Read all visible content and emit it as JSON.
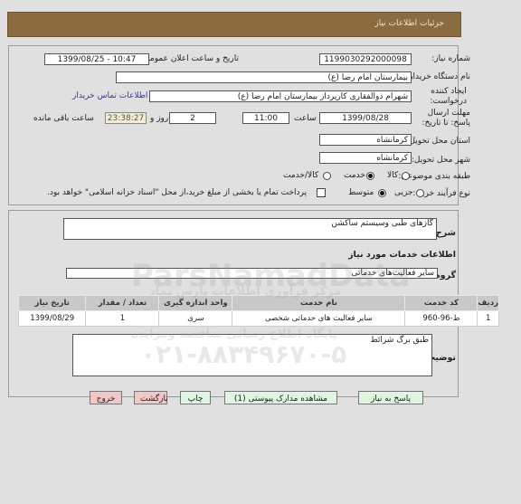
{
  "header": {
    "title": "جزئیات اطلاعات نیاز"
  },
  "form": {
    "need_number_label": "شماره نیاز:",
    "need_number": "1199030292000098",
    "announce_label": "تاریخ و ساعت اعلان عمومی:",
    "announce_value": "1399/08/25 - 10:47",
    "buyer_org_label": "نام دستگاه خریدار:",
    "buyer_org": "بیمارستان امام رضا (ع)",
    "creator_label": "ایجاد کننده درخواست:",
    "creator": "شهرام ذوالفقاری کارپرداز بیمارستان امام رضا (ع)",
    "buyer_contact_link": "اطلاعات تماس خریدار",
    "deadline_label": "مهلت ارسال پاسخ: تا تاریخ:",
    "deadline_date": "1399/08/28",
    "time_label": "ساعت",
    "deadline_time": "11:00",
    "days_value": "2",
    "days_label": "روز و",
    "remaining_time": "23:38:27",
    "remaining_label": "ساعت باقی مانده",
    "province_label": "استان محل تحویل:",
    "province": "کرمانشاه",
    "city_label": "شهر محل تحویل:",
    "city": "کرمانشاه",
    "category_label": "طبقه بندی موضوعی:",
    "category_options": [
      {
        "label": "کالا",
        "selected": false
      },
      {
        "label": "خدمت",
        "selected": true
      },
      {
        "label": "کالا/خدمت",
        "selected": false
      }
    ],
    "process_label": "نوع فرآیند خرید :",
    "process_options": [
      {
        "label": "جزیی",
        "selected": false
      },
      {
        "label": "متوسط",
        "selected": true
      }
    ],
    "payment_checkbox_checked": false,
    "payment_note": "پرداخت تمام یا بخشی از مبلغ خرید،از محل \"اسناد خزانه اسلامی\" خواهد بود."
  },
  "details": {
    "description_label": "شرح کلی نیاز:",
    "description": "گازهای طبی وسیستم ساکشن",
    "services_heading": "اطلاعات خدمات مورد نیاز",
    "service_group_label": "گروه خدمت:",
    "service_group": "سایر فعالیت‌های خدماتی",
    "table": {
      "headers": [
        "ردیف",
        "کد خدمت",
        "نام خدمت",
        "واحد اندازه گیری",
        "تعداد / مقدار",
        "تاریخ نیاز"
      ],
      "rows": [
        [
          "1",
          "ط-96-960",
          "سایر فعالیت های خدماتی شخصی",
          "سری",
          "1",
          "1399/08/29"
        ]
      ]
    },
    "buyer_notes_label": "توضیحات خریدار:",
    "buyer_notes": "طبق برگ شرائط"
  },
  "buttons": {
    "reply": "پاسخ به نیاز",
    "attachments": "مشاهده مدارک پیوستی (1)",
    "print": "چاپ",
    "back": "بازگشت",
    "exit": "خروج"
  },
  "watermark": {
    "brand": "ParsNamadData",
    "line1": "مرکز فرآوری اطلاعات پارس نماد",
    "line2": "پایگاه اطلاع رسانی مناقصه ومزایده",
    "phone": "۰۲۱-۸۸۳۴۹۶۷۰-۵"
  },
  "colors": {
    "header_bg": "#8b6b40",
    "page_bg": "#e0e0e0",
    "button_green": "#dff5df",
    "button_pink": "#f4c7c7",
    "link": "#3636a8",
    "timer_bg": "#f1eecf"
  }
}
